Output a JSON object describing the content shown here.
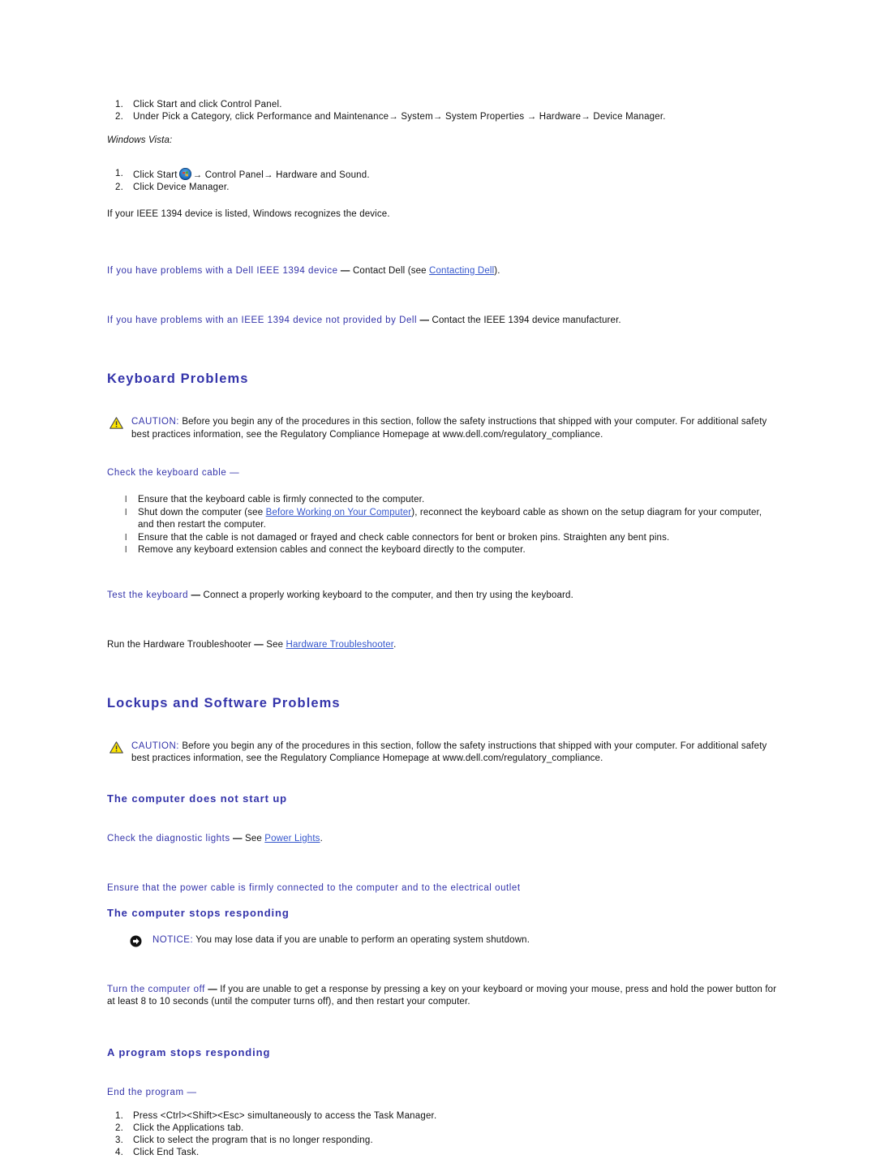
{
  "colors": {
    "heading_blue": "#3333aa",
    "link_blue": "#3355cc",
    "body_black": "#111111",
    "caution_yellow": "#ffe600",
    "page_background": "#ffffff"
  },
  "xp_steps": [
    "Click Start and click Control Panel.",
    "Under Pick a Category, click Performance and Maintenance→ System→ System Properties → Hardware→ Device Manager."
  ],
  "vista_label": "Windows Vista:",
  "vista_step1_pre": "Click Start",
  "vista_step1_post": "→ Control Panel→ Hardware and Sound.",
  "vista_step2": "Click Device Manager.",
  "recognize_note": "If your IEEE 1394 device is listed, Windows recognizes the device.",
  "ieee_dell": {
    "lead": "If you have problems with a Dell IEEE 1394 device",
    "dash": "—",
    "body_pre": "Contact Dell (see ",
    "link": "Contacting Dell",
    "body_post": ")."
  },
  "ieee_nondell": {
    "lead": "If you have problems with an IEEE 1394 device not provided by Dell",
    "dash": "—",
    "body": "Contact the IEEE 1394 device manufacturer."
  },
  "keyboard_section": {
    "title": "Keyboard Problems",
    "caution": {
      "keyword": "CAUTION:",
      "text": "Before you begin any of the procedures in this section, follow the safety instructions that shipped with your computer. For additional safety best practices information, see the Regulatory Compliance Homepage at www.dell.com/regulatory_compliance.",
      "icon": "caution-triangle-icon"
    },
    "check_cable_head": "Check the keyboard cable —",
    "bullets": [
      {
        "pre": "Ensure that the keyboard cable is firmly connected to the computer.",
        "link": "",
        "post": ""
      },
      {
        "pre": "Shut down the computer (see ",
        "link": "Before Working on Your Computer",
        "post": "), reconnect the keyboard cable as shown on the setup diagram for your computer, and then restart the computer."
      },
      {
        "pre": "Ensure that the cable is not damaged or frayed and check cable connectors for bent or broken pins. Straighten any bent pins.",
        "link": "",
        "post": ""
      },
      {
        "pre": "Remove any keyboard extension cables and connect the keyboard directly to the computer.",
        "link": "",
        "post": ""
      }
    ],
    "test_keyboard": {
      "lead": "Test the keyboard",
      "dash": "—",
      "body": "Connect a properly working keyboard to the computer, and then try using the keyboard."
    },
    "hw_troubleshooter": {
      "lead": "Run the Hardware Troubleshooter",
      "dash": "—",
      "body_pre": "See ",
      "link": "Hardware Troubleshooter",
      "body_post": "."
    }
  },
  "lockups_section": {
    "title": "Lockups and Software Problems",
    "caution": {
      "keyword": "CAUTION:",
      "text": "Before you begin any of the procedures in this section, follow the safety instructions that shipped with your computer. For additional safety best practices information, see the Regulatory Compliance Homepage at www.dell.com/regulatory_compliance.",
      "icon": "caution-triangle-icon"
    },
    "no_start": {
      "title": "The computer does not start up",
      "diag_lights": {
        "lead": "Check the diagnostic lights",
        "dash": "—",
        "body_pre": "See ",
        "link": "Power Lights",
        "body_post": "."
      },
      "power_cable": "Ensure that the power cable is firmly connected to the computer and to the electrical outlet"
    },
    "stops_responding": {
      "title": "The computer stops responding",
      "notice": {
        "keyword": "NOTICE:",
        "text": "You may lose data if you are unable to perform an operating system shutdown.",
        "icon": "notice-arrow-icon"
      },
      "turn_off": {
        "lead": "Turn the computer off",
        "dash": "—",
        "body": "If you are unable to get a response by pressing a key on your keyboard or moving your mouse, press and hold the power button for at least 8 to 10 seconds (until the computer turns off), and then restart your computer."
      }
    },
    "program_stops": {
      "title": "A program stops responding",
      "end_program_head": "End the program —",
      "steps": [
        "Press <Ctrl><Shift><Esc> simultaneously to access the Task Manager.",
        "Click the Applications tab.",
        "Click to select the program that is no longer responding.",
        "Click End Task."
      ]
    }
  },
  "icons": {
    "caution": "caution-triangle-icon",
    "notice": "notice-arrow-icon",
    "windows_start": "windows-vista-start-orb-icon"
  }
}
